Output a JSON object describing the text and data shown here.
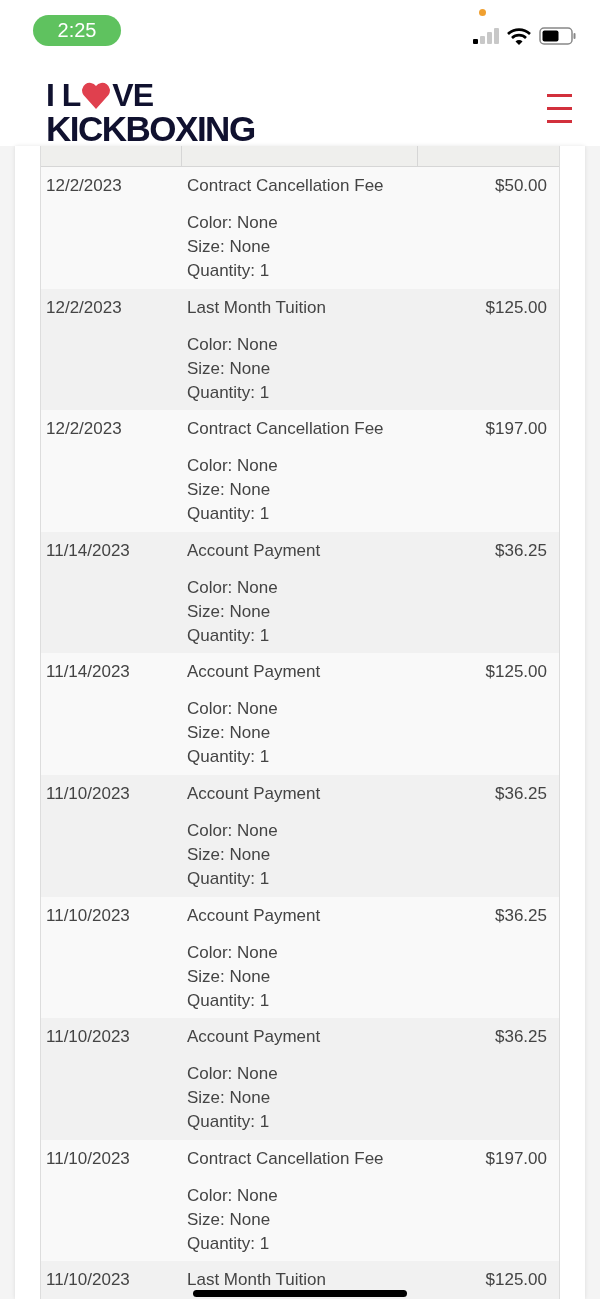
{
  "status_bar": {
    "time": "2:25"
  },
  "header": {
    "logo": {
      "line_1_start": "I L",
      "line_1_end": "VE",
      "line_2": "KICKBOXING"
    }
  },
  "table": {
    "rows": [
      {
        "date": "12/2/2023",
        "description": "Contract Cancellation Fee",
        "details": [
          "Color: None",
          "Size: None",
          "Quantity: 1"
        ],
        "amount": "$50.00"
      },
      {
        "date": "12/2/2023",
        "description": "Last Month Tuition",
        "details": [
          "Color: None",
          "Size: None",
          "Quantity: 1"
        ],
        "amount": "$125.00"
      },
      {
        "date": "12/2/2023",
        "description": "Contract Cancellation Fee",
        "details": [
          "Color: None",
          "Size: None",
          "Quantity: 1"
        ],
        "amount": "$197.00"
      },
      {
        "date": "11/14/2023",
        "description": "Account Payment",
        "details": [
          "Color: None",
          "Size: None",
          "Quantity: 1"
        ],
        "amount": "$36.25"
      },
      {
        "date": "11/14/2023",
        "description": "Account Payment",
        "details": [
          "Color: None",
          "Size: None",
          "Quantity: 1"
        ],
        "amount": "$125.00"
      },
      {
        "date": "11/10/2023",
        "description": "Account Payment",
        "details": [
          "Color: None",
          "Size: None",
          "Quantity: 1"
        ],
        "amount": "$36.25"
      },
      {
        "date": "11/10/2023",
        "description": "Account Payment",
        "details": [
          "Color: None",
          "Size: None",
          "Quantity: 1"
        ],
        "amount": "$36.25"
      },
      {
        "date": "11/10/2023",
        "description": "Account Payment",
        "details": [
          "Color: None",
          "Size: None",
          "Quantity: 1"
        ],
        "amount": "$36.25"
      },
      {
        "date": "11/10/2023",
        "description": "Contract Cancellation Fee",
        "details": [
          "Color: None",
          "Size: None",
          "Quantity: 1"
        ],
        "amount": "$197.00"
      },
      {
        "date": "11/10/2023",
        "description": "Last Month Tuition",
        "amount": "$125.00"
      }
    ]
  }
}
